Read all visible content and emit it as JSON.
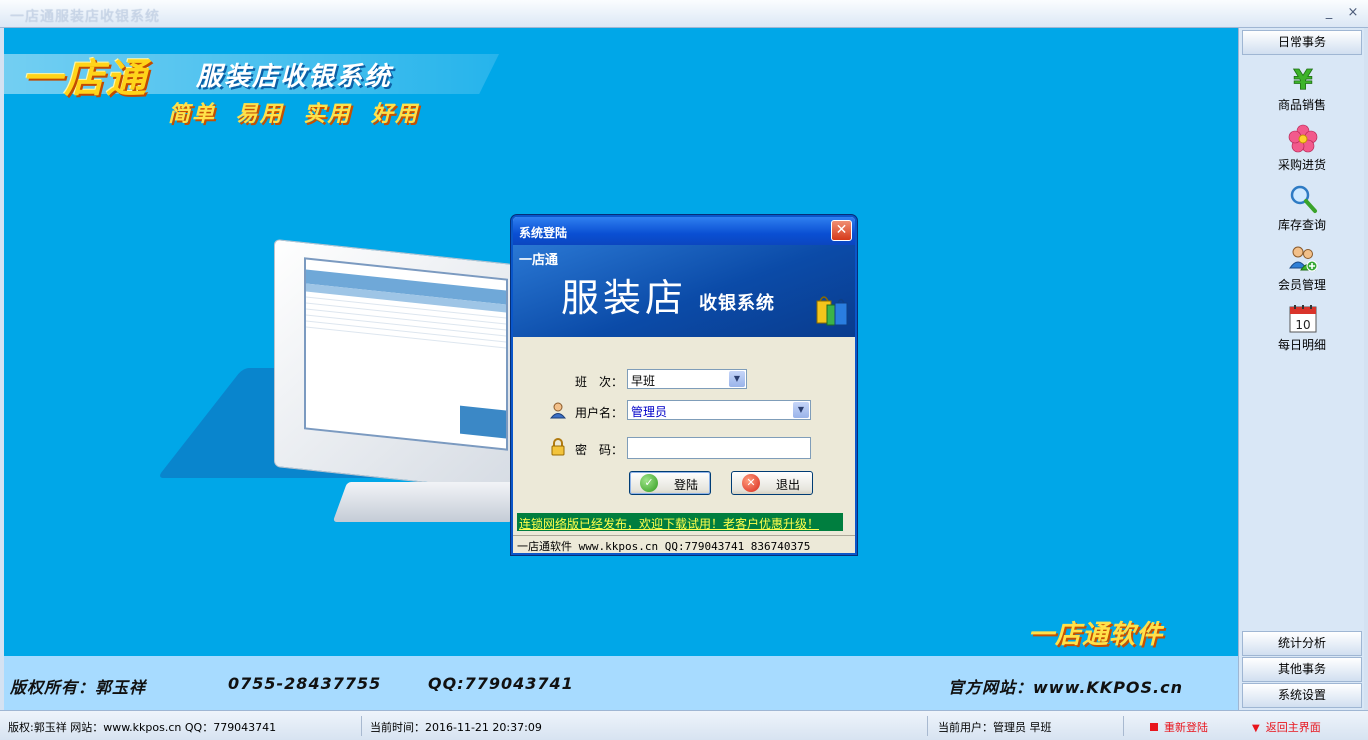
{
  "window": {
    "title": "一店通服装店收银系统",
    "minimize_glyph": "_",
    "close_glyph": "×"
  },
  "banner": {
    "logo": "一店通",
    "subtitle": "服装店收银系统",
    "slogan": "简单 易用 实用 好用",
    "brand_bottom": "一店通软件"
  },
  "info_band": {
    "copyright": "版权所有：郭玉祥",
    "phone": "0755-28437755",
    "qq": "QQ:779043741",
    "website": "官方网站：www.KKPOS.cn"
  },
  "login": {
    "title": "系统登陆",
    "close_glyph": "✕",
    "banner_brand": "一店通",
    "banner_title": "服装店",
    "banner_subtitle": "收银系统",
    "shift_label": "班　次：",
    "shift_value": "早班",
    "user_label": "用户名：",
    "user_value": "管理员",
    "password_label": "密　码：",
    "password_value": "",
    "login_button": "登陆",
    "exit_button": "退出",
    "marquee": "连锁网络版已经发布，欢迎下载试用！老客户优惠升级！",
    "status": "一店通软件  www.kkpos.cn  QQ:779043741  836740375"
  },
  "sidebar": {
    "top_header": "日常事务",
    "items": [
      {
        "label": "商品销售",
        "icon": "yen-icon"
      },
      {
        "label": "采购进货",
        "icon": "flower-icon"
      },
      {
        "label": "库存查询",
        "icon": "magnifier-icon"
      },
      {
        "label": "会员管理",
        "icon": "members-icon"
      },
      {
        "label": "每日明细",
        "icon": "calendar-icon",
        "day": "10"
      }
    ],
    "bottom_headers": [
      "统计分析",
      "其他事务",
      "系统设置"
    ]
  },
  "statusbar": {
    "copyright": "版权:郭玉祥  网站：www.kkpos.cn  QQ：779043741",
    "time": "当前时间：2016-11-21 20:37:09",
    "user": "当前用户：管理员 早班",
    "relogin": "重新登陆",
    "home": "返回主界面"
  },
  "colors": {
    "main_bg": "#00a7e8",
    "dialog_title": "#0a4fd3",
    "marquee_bg": "#007e3f",
    "marquee_text": "#ffff4d",
    "status_red": "#e8151d"
  }
}
